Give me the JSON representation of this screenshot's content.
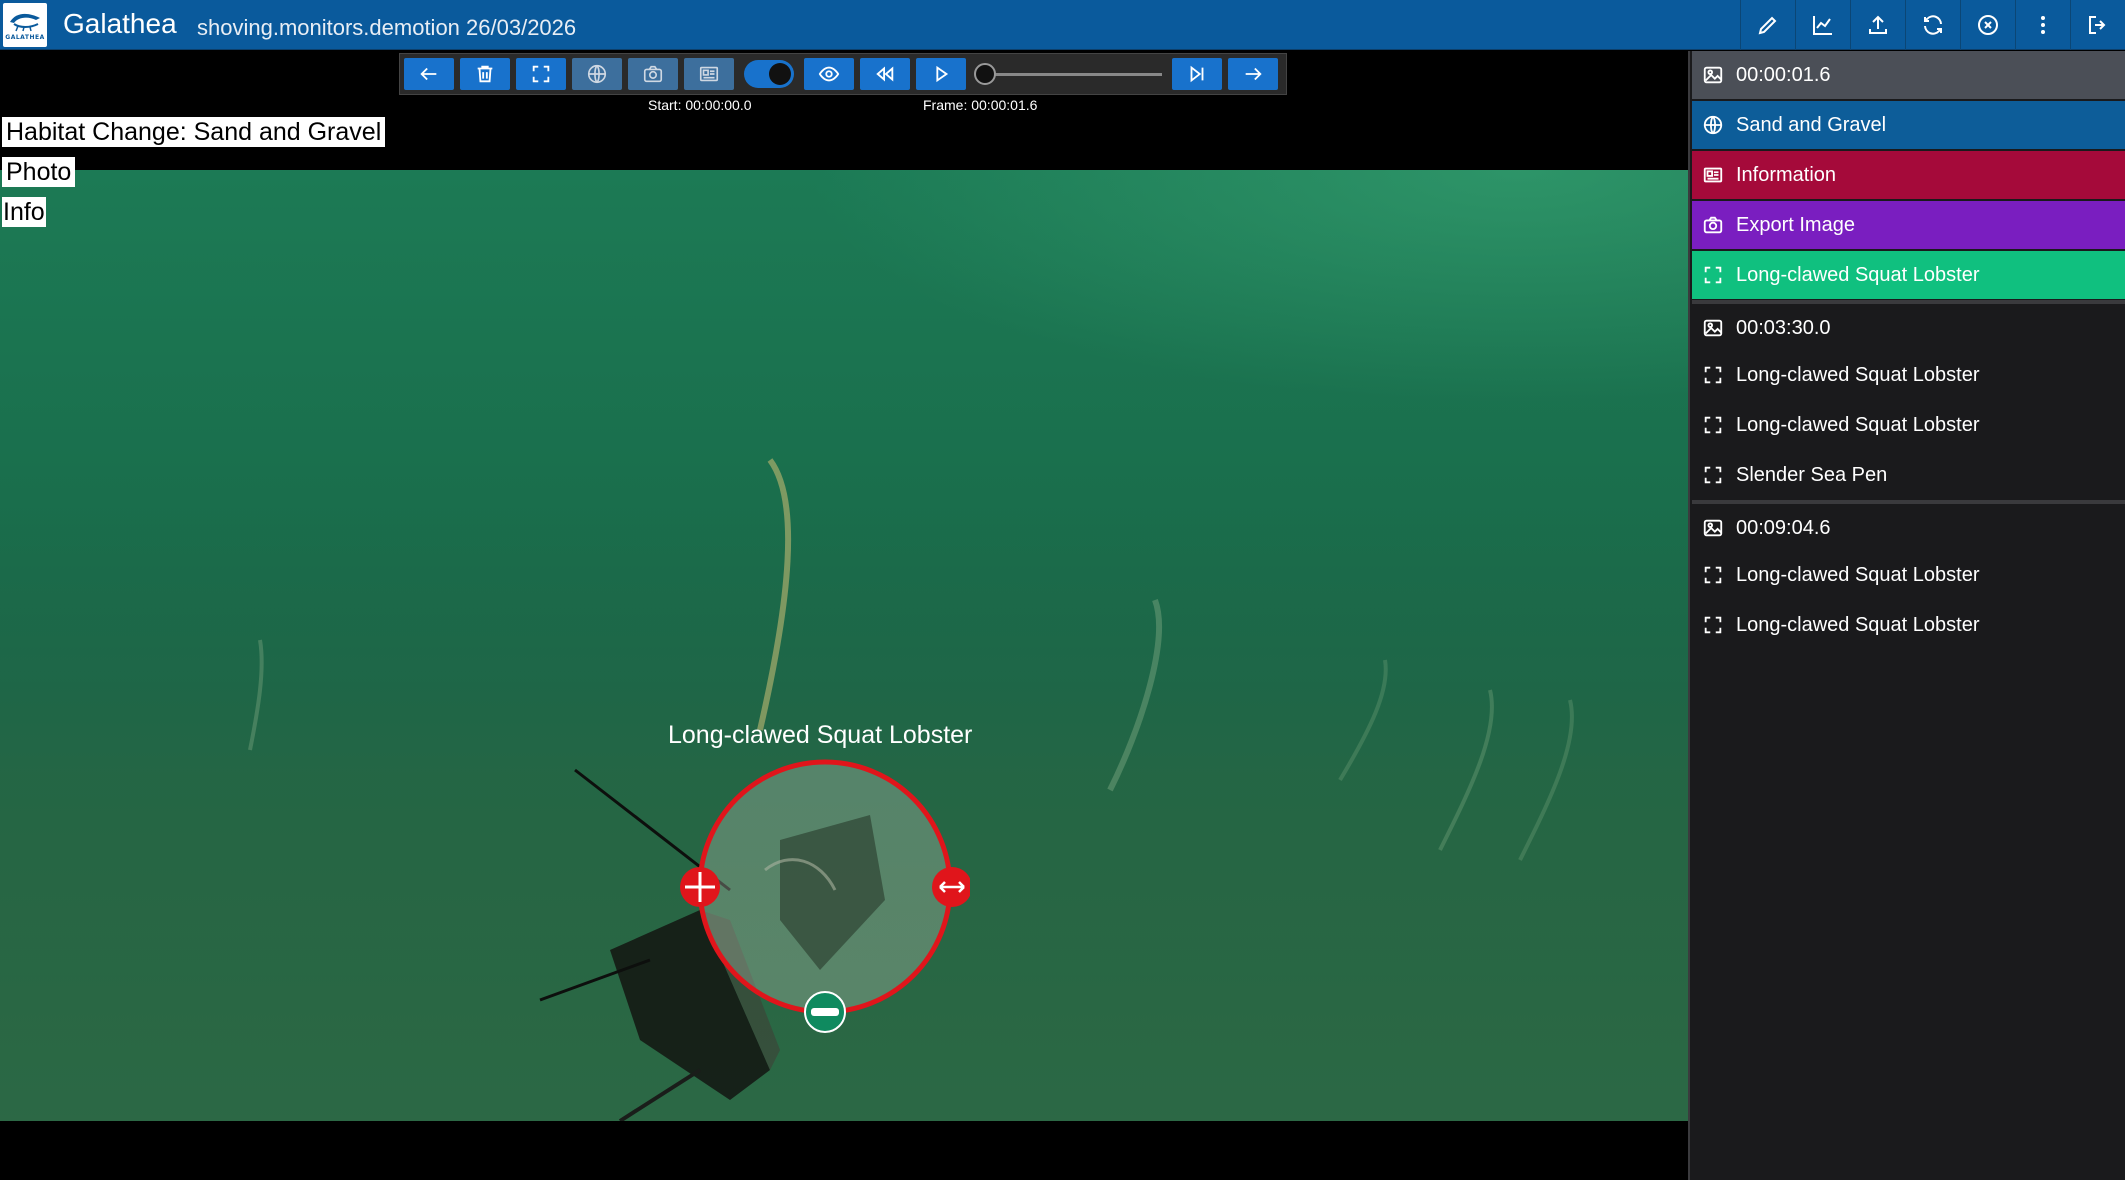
{
  "header": {
    "app_name": "Galathea",
    "subtitle": "shoving.monitors.demotion 26/03/2026",
    "logo_text": "GALATHEA",
    "actions": [
      "pencil-icon",
      "chart-icon",
      "upload-icon",
      "refresh-icon",
      "close-circle-icon",
      "more-vertical-icon",
      "logout-icon"
    ]
  },
  "toolbar": {
    "buttons": [
      "arrow-left-icon",
      "trash-icon",
      "frame-icon",
      "globe-icon",
      "camera-icon",
      "id-card-icon"
    ],
    "toggle_on": true,
    "playback": [
      "eye-icon",
      "rewind-icon",
      "play-icon"
    ],
    "slider_position": 0,
    "end_buttons": [
      "skip-end-icon",
      "arrow-right-icon"
    ],
    "start_label": "Start: 00:00:00.0",
    "frame_label": "Frame: 00:00:01.6"
  },
  "overlay": {
    "habitat": "Habitat Change: Sand and Gravel",
    "photo": "Photo",
    "info": "Info"
  },
  "annotation": {
    "label": "Long-clawed Squat Lobster",
    "ring_color": "#e0151b",
    "handle_color": "#0f8a5f"
  },
  "sidebar": {
    "groups": [
      {
        "time": "00:00:01.6",
        "items": [
          {
            "label": "Sand and Gravel",
            "icon": "globe-icon",
            "color": "#0d5d99"
          },
          {
            "label": "Information",
            "icon": "id-card-icon",
            "color": "#a50a3a"
          },
          {
            "label": "Export Image",
            "icon": "camera-icon",
            "color": "#7a1ec0"
          },
          {
            "label": "Long-clawed Squat Lobster",
            "icon": "frame-icon",
            "color": "#10c07f"
          }
        ]
      },
      {
        "time": "00:03:30.0",
        "items": [
          {
            "label": "Long-clawed Squat Lobster",
            "icon": "frame-icon"
          },
          {
            "label": "Long-clawed Squat Lobster",
            "icon": "frame-icon"
          },
          {
            "label": "Slender Sea Pen",
            "icon": "frame-icon"
          }
        ]
      },
      {
        "time": "00:09:04.6",
        "items": [
          {
            "label": "Long-clawed Squat Lobster",
            "icon": "frame-icon"
          },
          {
            "label": "Long-clawed Squat Lobster",
            "icon": "frame-icon"
          }
        ]
      }
    ]
  },
  "colors": {
    "header_bg": "#0a5a9c",
    "button_blue": "#1872cc",
    "active_time_bg": "#4b4f57"
  }
}
